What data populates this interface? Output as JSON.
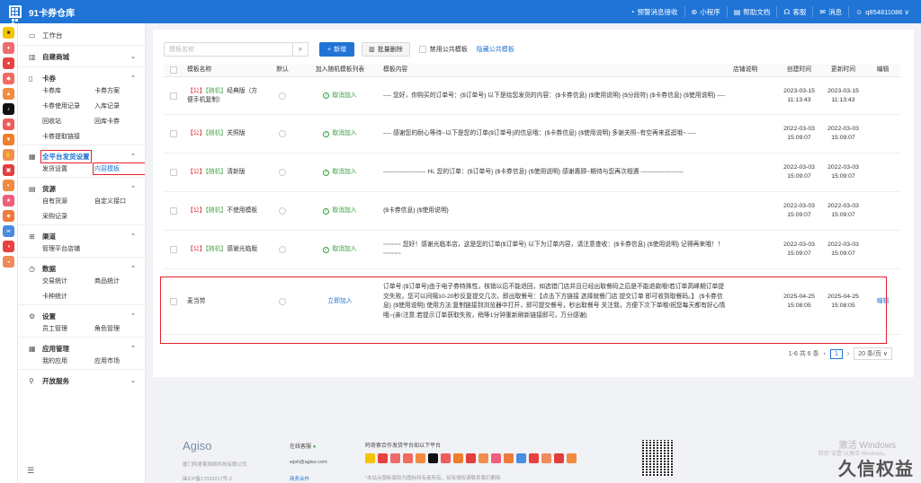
{
  "header": {
    "brand": "91卡券仓库",
    "items": [
      {
        "icon": "bell-icon",
        "label": "预警消息接收"
      },
      {
        "icon": "mini-program-icon",
        "label": "小程序"
      },
      {
        "icon": "doc-icon",
        "label": "帮助文档"
      },
      {
        "icon": "headset-icon",
        "label": "客服"
      },
      {
        "icon": "mail-icon",
        "label": "消息"
      },
      {
        "icon": "user-icon",
        "label": "q854811086 ∨"
      }
    ]
  },
  "sidebar": {
    "workbench": "工作台",
    "groups": [
      {
        "title": "自建商城",
        "icon": "shop-icon",
        "items": []
      },
      {
        "title": "卡券",
        "icon": "card-icon",
        "items": [
          "卡券库",
          "卡券方案",
          "卡券使用记录",
          "入库记录",
          "回收站",
          "回库卡券",
          "卡券提取链接"
        ]
      },
      {
        "title": "全平台发货设置",
        "icon": "platform-icon",
        "items": [
          "发货设置",
          "内容模板"
        ]
      },
      {
        "title": "货源",
        "icon": "source-icon",
        "items": [
          "自有货源",
          "自定义接口",
          "采购记录"
        ]
      },
      {
        "title": "渠道",
        "icon": "channel-icon",
        "items": [
          "管理平台店铺"
        ]
      },
      {
        "title": "数据",
        "icon": "data-icon",
        "items": [
          "交易统计",
          "商品统计",
          "卡种统计"
        ]
      },
      {
        "title": "设置",
        "icon": "settings-icon",
        "items": [
          "员工管理",
          "角色管理"
        ]
      },
      {
        "title": "应用管理",
        "icon": "apps-icon",
        "items": [
          "我的应用",
          "应用市场"
        ]
      },
      {
        "title": "开放服务",
        "icon": "open-icon",
        "items": []
      }
    ]
  },
  "toolbar": {
    "search_placeholder": "模板名称",
    "add_label": "新增",
    "batch_delete_label": "批量删除",
    "disable_public_label": "禁用公共模板",
    "hide_public_label": "隐藏公共模板"
  },
  "table": {
    "headers": [
      "模板名称",
      "默认",
      "加入随机模板列表",
      "模板内容",
      "店铺说明",
      "创建时间",
      "更新时间",
      "编辑"
    ],
    "rows": [
      {
        "tag_pub": "【公】",
        "tag_rand": "【随机】",
        "name": "经典版（方便手机复制）",
        "action": "取消加入",
        "content": "---- 您好，你购买的订单号：{$订单号} 以下是给您发货的内容：{$卡券信息} {$使用说明} {$分段符} {$卡券信息} {$使用说明} ----",
        "created": "2023-03-15 11:13:43",
        "updated": "2023-03-15 11:13:43",
        "edit": ""
      },
      {
        "tag_pub": "【公】",
        "tag_rand": "【随机】",
        "name": "关照版",
        "action": "取消加入",
        "content": "---- 感谢您的耐心等待~以下是您的订单{$订单号}的信息哦：{$卡券信息} {$使用说明} 多谢关照~有空再来逛逛哦~ ----",
        "created": "2022-03-03 15:09:07",
        "updated": "2022-03-03 15:09:07",
        "edit": ""
      },
      {
        "tag_pub": "【公】",
        "tag_rand": "【随机】",
        "name": "清新版",
        "action": "取消加入",
        "content": "--------------------- Hi, 您的订单：{$订单号} {$卡券信息} {$使用说明} 感谢惠顾~期待与您再次相遇 ---------------------",
        "created": "2022-03-03 15:09:07",
        "updated": "2022-03-03 15:09:07",
        "edit": ""
      },
      {
        "tag_pub": "【公】",
        "tag_rand": "【随机】",
        "name": "不使用模板",
        "action": "取消加入",
        "content": "{$卡券信息} {$使用说明}",
        "created": "2022-03-03 15:09:07",
        "updated": "2022-03-03 15:09:07",
        "edit": ""
      },
      {
        "tag_pub": "【公】",
        "tag_rand": "【随机】",
        "name": "感谢光临版",
        "action": "取消加入",
        "content": "~~~~~ 您好！感谢光临本店，这是您的订单{$订单号} 以下为订单内容，请注意查收：{$卡券信息} {$使用说明} 记得再来哦！！ ~~~~~",
        "created": "2022-03-03 15:09:07",
        "updated": "2022-03-03 15:09:07",
        "edit": ""
      },
      {
        "tag_pub": "",
        "tag_rand": "",
        "name": "麦当劳",
        "action": "立即加入",
        "content": "订单号:{$订单号}由于电子券特殊性，核销以后不能退回，如选错门店并且已经出取餐码之后是不能退款哦!若订单高峰期订单提交失败，您可以间隔10-20秒反复提交几次，即出取餐号：【点击下方链接 选择就餐门店 提交订单 即可收到取餐码。】 {$卡券信息} {$使用说明} 使用方法:复制链接到浏览器中打开，即可提交餐号，秒出取餐号 关注我，方便下次下单哦!祝您每天都有好心情哦~{亲!注意:若提示订单获取失败，稍等1分钟重新刷新链接即可，万分感谢}",
        "created": "2025-04-25 15:08:05",
        "updated": "2025-04-25 15:08:05",
        "edit": "编辑"
      }
    ]
  },
  "pager": {
    "summary": "1-6 共 6 条",
    "prev": "‹",
    "current": "1",
    "next": "›",
    "size": "20 条/页 ∨"
  },
  "footer": {
    "brand": "Agiso",
    "company": "厦门阿奇索网络科技有限公司",
    "icp": "闽ICP备17029217号-2",
    "online_label": "在线客服",
    "email": "wjsh@agiso.com",
    "partner": "商务合作",
    "platform_title": "阿奇索合作发货平台如以下平台",
    "platform_note": "*本站点图标版权为图标持有者所有，如有侵权请联系我们删除",
    "wm1": "激活 Windows",
    "wm2": "转到\"设置\"以激活 Windows。",
    "wm3": "久信权益"
  }
}
